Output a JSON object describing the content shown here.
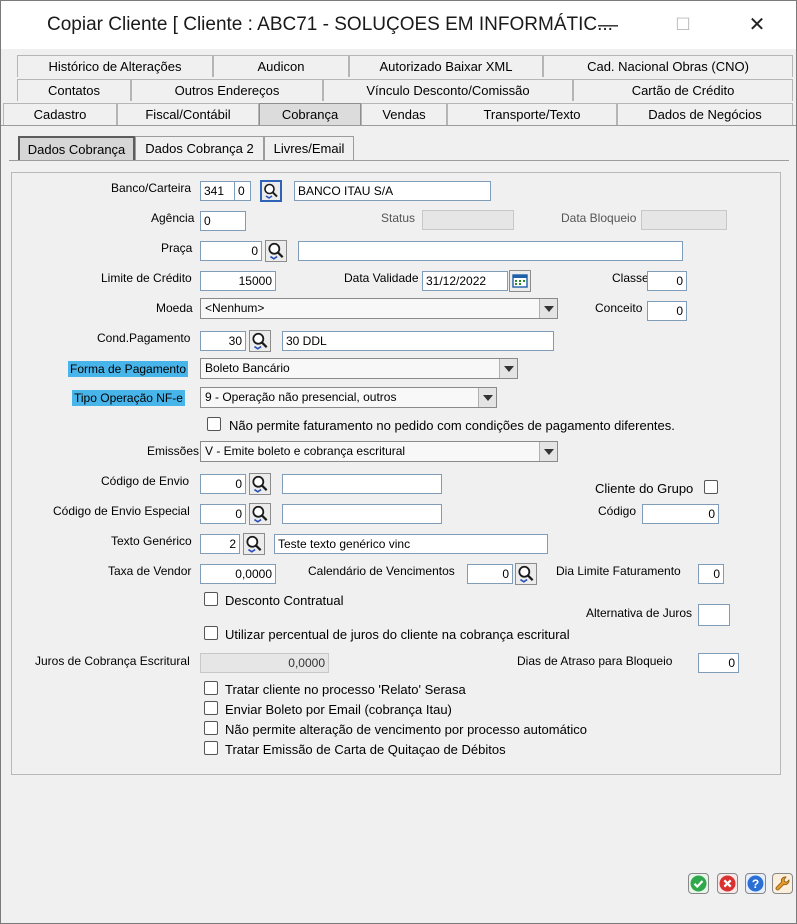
{
  "window": {
    "title": "Copiar Cliente [ Cliente : ABC71 - SOLUÇOES EM INFORMÁTIC...",
    "minimize": "—",
    "maximize": "☐",
    "close": "✕"
  },
  "tabs_row1": [
    "Histórico de Alterações",
    "Audicon",
    "Autorizado Baixar XML",
    "Cad. Nacional Obras (CNO)"
  ],
  "tabs_row2": [
    "Contatos",
    "Outros Endereços",
    "Vínculo Desconto/Comissão",
    "Cartão de Crédito"
  ],
  "tabs_row3": [
    "Cadastro",
    "Fiscal/Contábil",
    "Cobrança",
    "Vendas",
    "Transporte/Texto",
    "Dados de Negócios"
  ],
  "active_tab": "Cobrança",
  "subtabs": [
    "Dados Cobrança",
    "Dados Cobrança 2",
    "Livres/Email"
  ],
  "form": {
    "banco_label": "Banco/Carteira",
    "banco_code": "341",
    "banco_carteira": "0",
    "banco_name": "BANCO ITAU S/A",
    "agencia_label": "Agência",
    "agencia_value": "0",
    "status_label": "Status",
    "status_value": "",
    "data_bloqueio_label": "Data Bloqueio",
    "data_bloqueio_value": "",
    "praca_label": "Praça",
    "praca_value": "0",
    "praca_desc": "",
    "limite_label": "Limite de Crédito",
    "limite_value": "15000",
    "data_validade_label": "Data Validade",
    "data_validade_value": "31/12/2022",
    "classe_label": "Classe",
    "classe_value": "0",
    "moeda_label": "Moeda",
    "moeda_value": "<Nenhum>",
    "conceito_label": "Conceito",
    "conceito_value": "0",
    "cond_label": "Cond.Pagamento",
    "cond_value": "30",
    "cond_desc": "30 DDL",
    "forma_label": "Forma de Pagamento",
    "forma_value": "Boleto Bancário",
    "tipo_label": "Tipo Operação NF-e",
    "tipo_value": "9 - Operação não presencial, outros",
    "nao_permite_fat": "Não permite faturamento no pedido com condições de pagamento diferentes.",
    "emissoes_label": "Emissões",
    "emissoes_value": "V - Emite boleto e cobrança escritural",
    "cod_envio_label": "Código de Envio",
    "cod_envio_value": "0",
    "cod_envio_desc": "",
    "cliente_grupo_label": "Cliente do Grupo",
    "cod_envio_esp_label": "Código de Envio Especial",
    "cod_envio_esp_value": "0",
    "cod_envio_esp_desc": "",
    "codigo_label": "Código",
    "codigo_value": "0",
    "texto_gen_label": "Texto Genérico",
    "texto_gen_value": "2",
    "texto_gen_desc": "Teste texto genérico vinc",
    "taxa_vendor_label": "Taxa de Vendor",
    "taxa_vendor_value": "0,0000",
    "calendario_label": "Calendário de Vencimentos",
    "calendario_value": "0",
    "dia_limite_label": "Dia Limite Faturamento",
    "dia_limite_value": "0",
    "desconto_contratual": "Desconto Contratual",
    "alternativa_juros_label": "Alternativa de Juros",
    "alternativa_juros_value": "",
    "utilizar_percentual": "Utilizar percentual de juros do cliente na cobrança escritural",
    "juros_label": "Juros de Cobrança Escritural",
    "juros_value": "0,0000",
    "dias_atraso_label": "Dias de Atraso para Bloqueio",
    "dias_atraso_value": "0",
    "tratar_relato": "Tratar cliente no processo 'Relato' Serasa",
    "enviar_boleto": "Enviar Boleto por Email (cobrança Itau)",
    "nao_permite_alt": "Não permite alteração de vencimento por processo automático",
    "tratar_emissao": "Tratar Emissão de Carta de Quitaçao de Débitos"
  },
  "colors": {
    "highlight": "#48b5ea",
    "ok": "#2ea84a",
    "cancel": "#d93030",
    "help": "#2a6fd6",
    "tool": "#e89a2c"
  },
  "footer_icons": [
    "ok-icon",
    "cancel-icon",
    "help-icon",
    "wrench-icon"
  ]
}
